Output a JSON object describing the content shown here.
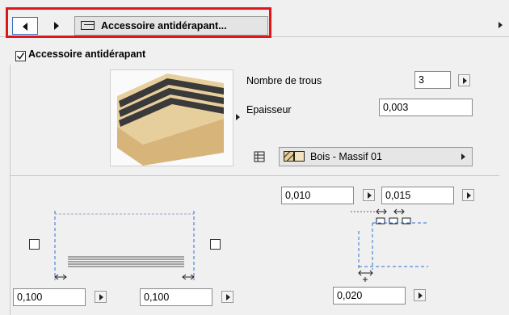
{
  "header": {
    "title": "Accessoire antidérapant...",
    "highlight_color": "#e0161b"
  },
  "section": {
    "checkbox_label": "Accessoire antidérapant",
    "checkbox_checked": true
  },
  "params": {
    "holes_label": "Nombre de trous",
    "holes_value": "3",
    "thickness_label": "Epaisseur",
    "thickness_value": "0,003",
    "material_value": "Bois - Massif 01"
  },
  "dimensions": {
    "top_left_value": "0,010",
    "top_right_value": "0,015",
    "bottom_value": "0,020",
    "left_offset_value": "0,100",
    "right_offset_value": "0,100"
  },
  "icons": {
    "back": "arrow-left-icon",
    "forward": "arrow-right-icon",
    "panel": "panel-icon",
    "surface": "surface-icon",
    "material": "material-swatch-icon"
  }
}
